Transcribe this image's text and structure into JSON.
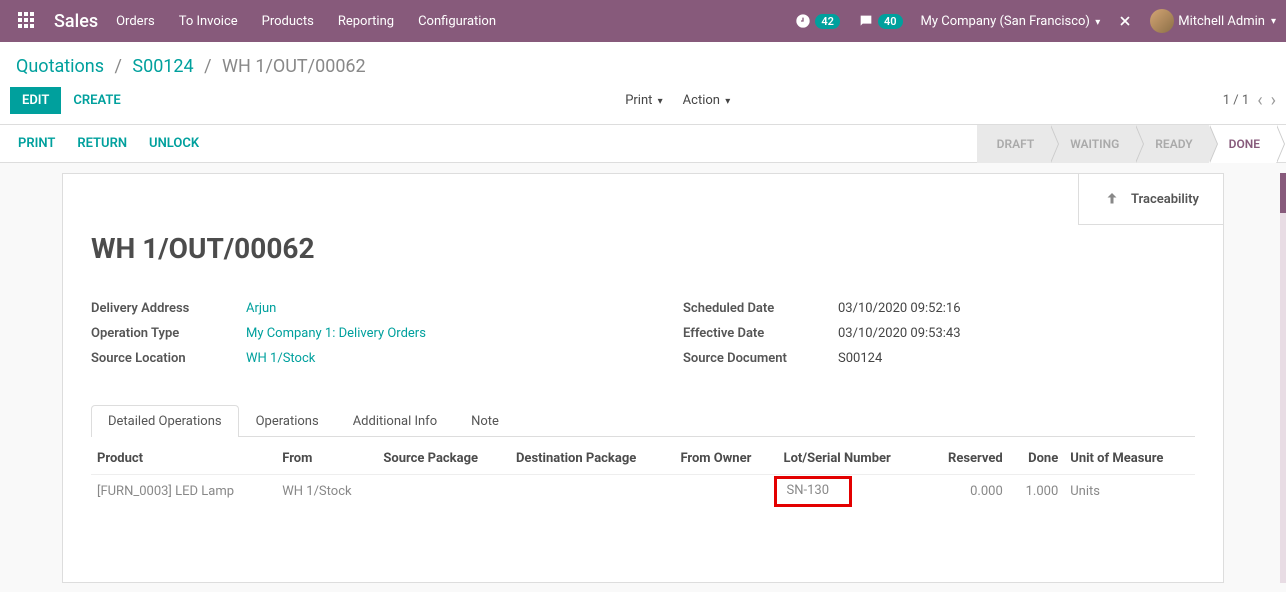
{
  "topnav": {
    "brand": "Sales",
    "links": [
      "Orders",
      "To Invoice",
      "Products",
      "Reporting",
      "Configuration"
    ],
    "activity_badge": "42",
    "chat_badge": "40",
    "company": "My Company (San Francisco)",
    "user": "Mitchell Admin"
  },
  "breadcrumb": {
    "root": "Quotations",
    "mid": "S00124",
    "current": "WH 1/OUT/00062"
  },
  "controls": {
    "edit": "EDIT",
    "create": "CREATE",
    "print": "Print",
    "action": "Action",
    "pager": "1 / 1"
  },
  "statusbar": {
    "actions": [
      "PRINT",
      "RETURN",
      "UNLOCK"
    ],
    "steps": [
      "DRAFT",
      "WAITING",
      "READY",
      "DONE"
    ]
  },
  "card": {
    "traceability": "Traceability",
    "title": "WH 1/OUT/00062",
    "left_fields": [
      {
        "label": "Delivery Address",
        "value": "Arjun",
        "link": true
      },
      {
        "label": "Operation Type",
        "value": "My Company 1: Delivery Orders",
        "link": true
      },
      {
        "label": "Source Location",
        "value": "WH 1/Stock",
        "link": true
      }
    ],
    "right_fields": [
      {
        "label": "Scheduled Date",
        "value": "03/10/2020 09:52:16"
      },
      {
        "label": "Effective Date",
        "value": "03/10/2020 09:53:43"
      },
      {
        "label": "Source Document",
        "value": "S00124"
      }
    ],
    "tabs": [
      "Detailed Operations",
      "Operations",
      "Additional Info",
      "Note"
    ],
    "table": {
      "headers": [
        "Product",
        "From",
        "Source Package",
        "Destination Package",
        "From Owner",
        "Lot/Serial Number",
        "Reserved",
        "Done",
        "Unit of Measure"
      ],
      "row": {
        "product": "[FURN_0003] LED Lamp",
        "from": "WH 1/Stock",
        "source_package": "",
        "destination_package": "",
        "from_owner": "",
        "lot_serial": "SN-130",
        "reserved": "0.000",
        "done": "1.000",
        "uom": "Units"
      }
    }
  }
}
